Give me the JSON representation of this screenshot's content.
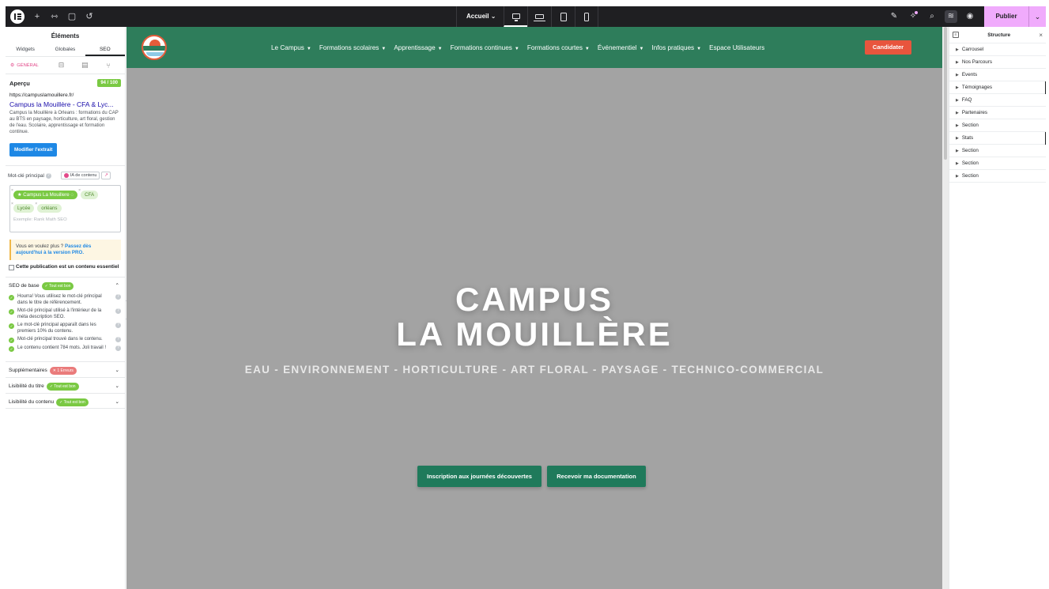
{
  "topbar": {
    "page_selector": "Accueil",
    "publish_label": "Publier"
  },
  "left_panel": {
    "title": "Éléments",
    "tabs": [
      "Widgets",
      "Globales",
      "SEO"
    ],
    "seo_general_tab": "GÉNÉRAL",
    "apercu": {
      "heading": "Aperçu",
      "score": "94 / 100",
      "url": "https://campuslamouillere.fr/",
      "serp_title": "Campus la Mouillère - CFA & Lyc...",
      "serp_description": "Campus la Mouillère à Orleans : formations du CAP au BTS en paysage, horticulture, art floral, gestion de l'eau. Scolaire, apprentissage et formation continue.",
      "edit_button": "Modifier l'extrait"
    },
    "keyword": {
      "label": "Mot-clé principal",
      "ai_button": "IA de contenu",
      "tags": [
        "Campus La Mouillere",
        "CFA",
        "Lycée",
        "orléans"
      ],
      "placeholder": "Exemple: Rank Math SEO"
    },
    "pro_notice": {
      "text": "Vous en voulez plus ?",
      "link": "Passez dès aujourd'hui à la version PRO."
    },
    "essential_checkbox": "Cette publication est un contenu essentiel",
    "seo_base": {
      "label": "SEO de base",
      "status": "✓ Tout est bon",
      "checks": [
        "Hourra! Vous utilisez le mot-clé principal dans le titre de référencement.",
        "Mot-clé principal utilisé à l'intérieur de la méta description SEO.",
        "Le mot-clé principal apparaît dans les premiers 10% du contenu.",
        "Mot-clé principal trouvé dans le contenu.",
        "Le contenu contient 784 mots. Joli travail !"
      ]
    },
    "collapsed_sections": [
      {
        "label": "Supplémentaires",
        "status": "✕ 1 Erreurs",
        "type": "error"
      },
      {
        "label": "Lisibilité du titre",
        "status": "✓ Tout est bon",
        "type": "ok"
      },
      {
        "label": "Lisibilité du contenu",
        "status": "✓ Tout est bon",
        "type": "ok"
      }
    ]
  },
  "site": {
    "nav": [
      "Le Campus",
      "Formations scolaires",
      "Apprentissage",
      "Formations continues",
      "Formations courtes",
      "Événementiel",
      "Infos pratiques",
      "Espace Utilisateurs"
    ],
    "cta": "Candidater",
    "hero_title_line1": "CAMPUS",
    "hero_title_line2": "LA MOUILLÈRE",
    "hero_subtitle": "EAU - ENVIRONNEMENT - HORTICULTURE - ART FLORAL - PAYSAGE - TECHNICO-COMMERCIAL",
    "button_1": "Inscription aux journées découvertes",
    "button_2": "Recevoir ma documentation"
  },
  "structure_panel": {
    "title": "Structure",
    "items": [
      "Carrousel",
      "Nos Parcours",
      "Events",
      "Témoignages",
      "FAQ",
      "Partenaires",
      "Section",
      "Stats",
      "Section",
      "Section",
      "Section"
    ]
  },
  "colors": {
    "site_green": "#2e7d5b",
    "cta_red": "#e8553d",
    "publish_pink": "#f0abfc",
    "rankmath_green": "#7ac943"
  }
}
